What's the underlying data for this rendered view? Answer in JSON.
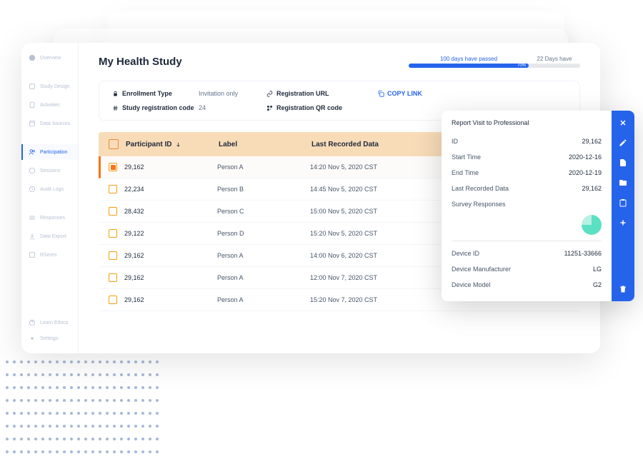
{
  "sidebar": {
    "items": [
      {
        "label": "Overview",
        "icon": "overview"
      },
      {
        "label": "Study Design",
        "icon": "design"
      },
      {
        "label": "Activities",
        "icon": "activities"
      },
      {
        "label": "Data Sources",
        "icon": "datasources"
      },
      {
        "label": "Participation",
        "icon": "participation",
        "active": true
      },
      {
        "label": "Sessions",
        "icon": "sessions"
      },
      {
        "label": "Audit Logs",
        "icon": "auditlogs"
      },
      {
        "label": "Responses",
        "icon": "responses"
      },
      {
        "label": "Data Export",
        "icon": "dataexport"
      },
      {
        "label": "RSeres",
        "icon": "rseres"
      }
    ],
    "bottom": [
      {
        "label": "Learn Ethica",
        "icon": "learn"
      },
      {
        "label": "Settings",
        "icon": "settings"
      }
    ]
  },
  "header": {
    "title": "My Health Study",
    "progress": {
      "passed_label": "100 days have passed",
      "remain_label": "22 Days have",
      "percent_label": "70%",
      "percent": 70
    }
  },
  "info": {
    "enrollment_type_label": "Enrollment Type",
    "enrollment_type_value": "Invitation only",
    "reg_code_label": "Study registration code",
    "reg_code_value": "24",
    "reg_url_label": "Registration URL",
    "reg_qr_label": "Registration QR code",
    "copy_link_label": "COPY LINK"
  },
  "table": {
    "columns": {
      "pid": "Participant ID",
      "label": "Label",
      "last": "Last Recorded Data"
    },
    "rows": [
      {
        "pid": "29,162",
        "label": "Person A",
        "last": "14:20 Nov 5, 2020 CST",
        "selected": true
      },
      {
        "pid": "22,234",
        "label": "Person B",
        "last": "14:45 Nov 5, 2020 CST"
      },
      {
        "pid": "28,432",
        "label": "Person C",
        "last": "15:00 Nov 5, 2020 CST"
      },
      {
        "pid": "29,122",
        "label": "Person D",
        "last": "15:20 Nov 5, 2020 CST"
      },
      {
        "pid": "29,162",
        "label": "Person A",
        "last": "14:00 Nov 6, 2020 CST"
      },
      {
        "pid": "29,162",
        "label": "Person A",
        "last": "12:00 Nov 7, 2020 CST"
      },
      {
        "pid": "29,162",
        "label": "Person A",
        "last": "15:20 Nov 7, 2020 CST"
      }
    ]
  },
  "panel": {
    "title": "Report Visit to Professional",
    "rows1": [
      {
        "k": "ID",
        "v": "29,162"
      },
      {
        "k": "Start Time",
        "v": "2020-12-16"
      },
      {
        "k": "End Time",
        "v": "2020-12-19"
      },
      {
        "k": "Last Recorded Data",
        "v": "29,162"
      }
    ],
    "survey_label": "Survey Responses",
    "rows2": [
      {
        "k": "Device ID",
        "v": "11251-33666"
      },
      {
        "k": "Device Manufacturer",
        "v": "LG"
      },
      {
        "k": "Device Model",
        "v": "G2"
      }
    ]
  }
}
